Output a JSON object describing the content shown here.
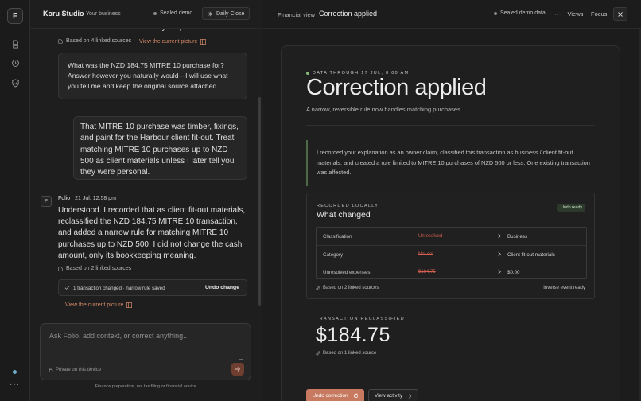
{
  "rail": {
    "logo": "F",
    "icons": [
      "document-icon",
      "history-icon",
      "shield-check-icon"
    ]
  },
  "chat": {
    "header": {
      "brand": "Koru Studio",
      "workspace": "Your business",
      "sealed": "Sealed demo",
      "daily_close": "Daily Close"
    },
    "partial_text": "takes cash NZD 60.23 below your protected reserve.",
    "sources_top": "Based on 4 linked sources",
    "view_picture_top": "View the current picture",
    "bubble1": "What was the NZD 184.75 MITRE 10 purchase for? Answer however you naturally would—I will use what you tell me and keep the original source attached.",
    "bubble2": "That MITRE 10 purchase was timber, fixings, and paint for the Harbour client fit-out. Treat matching MITRE 10 purchases up to NZD 500 as client materials unless I later tell you they were personal.",
    "reply": {
      "avatar": "F",
      "sender": "Folio",
      "time": "21 Jul, 12:58 pm",
      "text": "Understood. I recorded that as client fit-out materials, reclassified the NZD 184.75 MITRE 10 transaction, and added a narrow rule for matching MITRE 10 purchases up to NZD 500. I did not change the cash amount, only its bookkeeping meaning.",
      "sources": "Based on 2 linked sources",
      "change_text": "1 transaction changed · narrow rule saved",
      "undo": "Undo change",
      "view_picture": "View the current picture"
    },
    "composer": {
      "placeholder": "Ask Folio, add context, or correct anything...",
      "private": "Private on this device"
    },
    "footer": "Finance preparation, not tax filing or financial advice."
  },
  "right": {
    "header": {
      "section": "Financial view",
      "title": "Correction applied",
      "sealed": "Sealed demo data",
      "views": "Views",
      "focus": "Focus"
    },
    "card": {
      "eyebrow": "DATA THROUGH 17 JUL, 8:00 AM",
      "title": "Correction applied",
      "subtitle": "A narrow, reversible rule now handles matching purchases",
      "quote": "I recorded your explanation as an owner claim, classified this transaction as business / client fit-out materials, and created a rule limited to MITRE 10 purchases of NZD 500 or less. One existing transaction was affected.",
      "what_changed": {
        "label": "RECORDED LOCALLY",
        "title": "What changed",
        "badge": "Undo ready",
        "rows": [
          {
            "field": "Classification",
            "before": "Unresolved",
            "after": "Business"
          },
          {
            "field": "Category",
            "before": "Not set",
            "after": "Client fit-out materials"
          },
          {
            "field": "Unresolved expenses",
            "before": "$184.75",
            "after": "$0.00"
          }
        ],
        "based": "Based on 2 linked sources",
        "inverse": "Inverse event ready"
      },
      "transaction": {
        "label": "TRANSACTION RECLASSIFIED",
        "amount": "$184.75",
        "based": "Based on 1 linked source"
      },
      "actions": {
        "undo": "Undo correction",
        "activity": "View activity"
      }
    }
  },
  "colors": {
    "accent": "#c77a5f",
    "link": "#d68a6a",
    "strike": "#d45f4f",
    "quote_bar": "#4b6a45"
  }
}
